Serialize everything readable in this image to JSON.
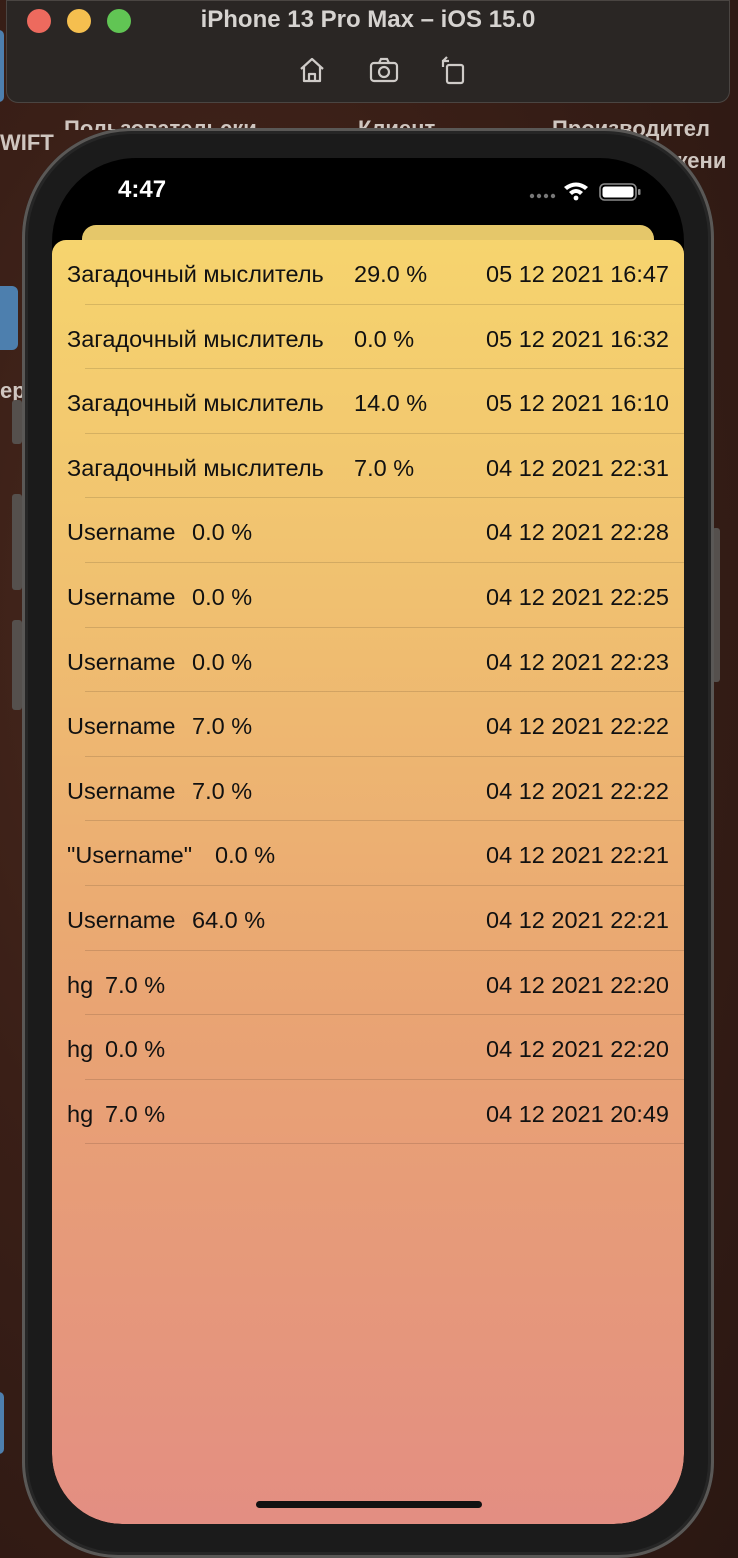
{
  "simulator": {
    "title": "iPhone 13 Pro Max – iOS 15.0",
    "tools": [
      "home-icon",
      "screenshot-icon",
      "rotate-icon"
    ]
  },
  "background": {
    "left_text": "WIFT",
    "col1": "Пользовательски",
    "col2": "Клиент",
    "col3": "Производител",
    "col3b": "жени",
    "side": "ер"
  },
  "status_bar": {
    "time": "4:47"
  },
  "rows": [
    {
      "name": "Загадочный мыслитель",
      "percent": "29.0 %",
      "date": "05 12 2021 16:47"
    },
    {
      "name": "Загадочный мыслитель",
      "percent": "0.0 %",
      "date": "05 12 2021 16:32"
    },
    {
      "name": "Загадочный мыслитель",
      "percent": "14.0 %",
      "date": "05 12 2021 16:10"
    },
    {
      "name": "Загадочный мыслитель",
      "percent": "7.0 %",
      "date": "04 12 2021 22:31"
    },
    {
      "name": "Username",
      "percent": "0.0 %",
      "date": "04 12 2021 22:28"
    },
    {
      "name": "Username",
      "percent": "0.0 %",
      "date": "04 12 2021 22:25"
    },
    {
      "name": "Username",
      "percent": "0.0 %",
      "date": "04 12 2021 22:23"
    },
    {
      "name": "Username",
      "percent": "7.0 %",
      "date": "04 12 2021 22:22"
    },
    {
      "name": "Username",
      "percent": "7.0 %",
      "date": "04 12 2021 22:22"
    },
    {
      "name": "\"Username\"",
      "percent": "0.0 %",
      "date": "04 12 2021 22:21"
    },
    {
      "name": "Username",
      "percent": "64.0 %",
      "date": "04 12 2021 22:21"
    },
    {
      "name": "hg",
      "percent": "7.0 %",
      "date": "04 12 2021 22:20"
    },
    {
      "name": "hg",
      "percent": "0.0 %",
      "date": "04 12 2021 22:20"
    },
    {
      "name": "hg",
      "percent": "7.0 %",
      "date": "04 12 2021 20:49"
    }
  ],
  "colors": {
    "sheet_top": "#f6d46e",
    "sheet_bottom": "#e38e82"
  }
}
